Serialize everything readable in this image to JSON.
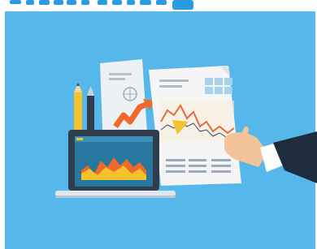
{
  "header": {
    "title_fragment": ""
  },
  "colors": {
    "background": "#56b8ea",
    "header_text": "#2a9be0",
    "paper": "#f4f4f4",
    "paper_shade": "#dfe3e8",
    "orange": "#ef6a2a",
    "yellow": "#f4c22b",
    "laptop_dark": "#2f3d4c",
    "laptop_screen": "#27779e",
    "hand": "#f3c39a",
    "cuff": "#ffffff",
    "sleeve": "#1e2d3e",
    "table_blue": "#a7d2ea"
  },
  "icons": [
    "pencil-icon",
    "pen-icon",
    "globe-icon",
    "cursor-arrow-icon",
    "laptop-icon",
    "hand-icon",
    "line-chart-icon",
    "bar-chart-icon"
  ]
}
